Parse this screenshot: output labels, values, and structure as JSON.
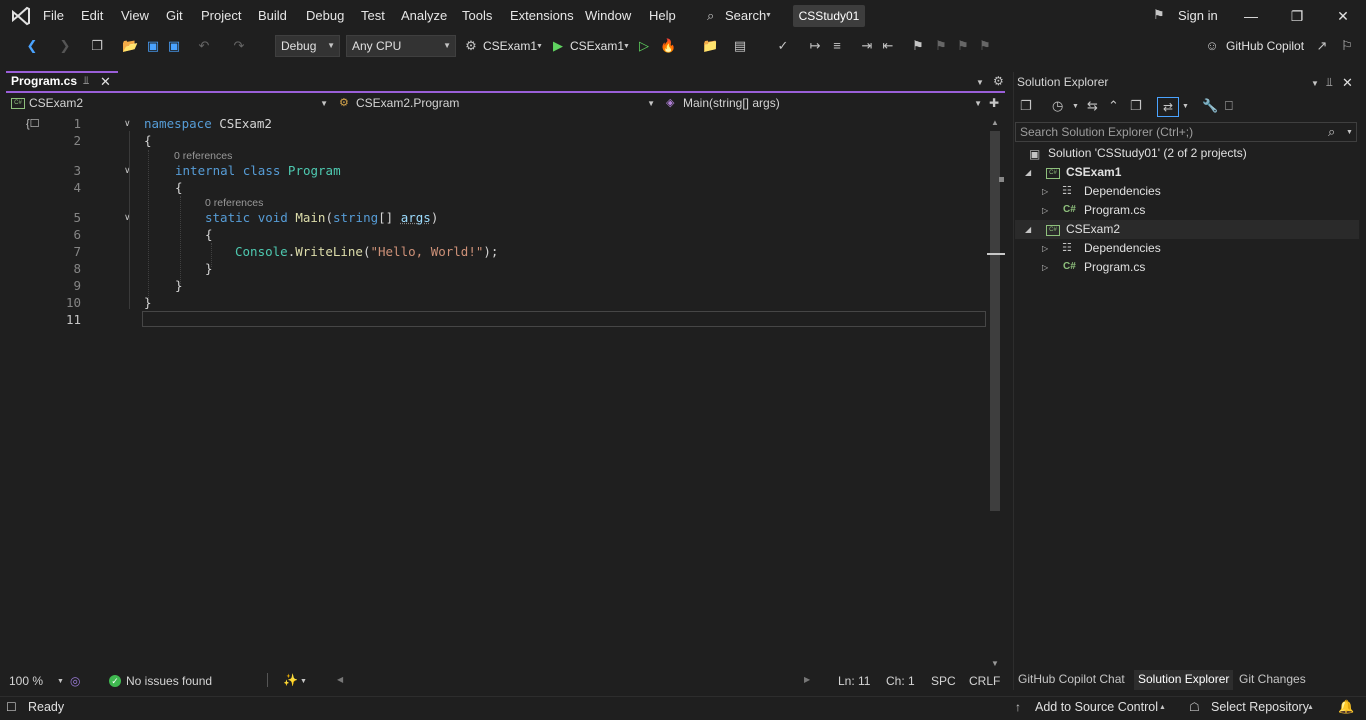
{
  "menu": {
    "items": [
      {
        "label": "File"
      },
      {
        "label": "Edit"
      },
      {
        "label": "View"
      },
      {
        "label": "Git"
      },
      {
        "label": "Project"
      },
      {
        "label": "Build"
      },
      {
        "label": "Debug"
      },
      {
        "label": "Test"
      },
      {
        "label": "Analyze"
      },
      {
        "label": "Tools"
      },
      {
        "label": "Extensions"
      },
      {
        "label": "Window"
      },
      {
        "label": "Help"
      }
    ],
    "search_label": "Search",
    "solution_name": "CSStudy01",
    "sign_in": "Sign in"
  },
  "toolbar": {
    "config": "Debug",
    "platform": "Any CPU",
    "startup_project": "CSExam1",
    "run_target": "CSExam1",
    "copilot": "GitHub Copilot"
  },
  "editor": {
    "tab_title": "Program.cs",
    "nav_project": "CSExam2",
    "nav_type": "CSExam2.Program",
    "nav_member": "Main(string[] args)",
    "line_numbers": [
      "1",
      "2",
      "3",
      "4",
      "5",
      "6",
      "7",
      "8",
      "9",
      "10",
      "11"
    ],
    "codelens": "0 references",
    "code": {
      "l1_kw": "namespace",
      "l1_name": "CSExam2",
      "open_brace": "{",
      "close_brace": "}",
      "l3_kw1": "internal",
      "l3_kw2": "class",
      "l3_name": "Program",
      "l5_kw1": "static",
      "l5_kw2": "void",
      "l5_meth": "Main",
      "l5_paren_open": "(",
      "l5_type": "string",
      "l5_arr": "[] ",
      "l5_param": "args",
      "l5_paren_close": ")",
      "l7_type": "Console",
      "l7_dot": ".",
      "l7_meth": "WriteLine",
      "l7_paren_open": "(",
      "l7_str": "\"Hello, World!\"",
      "l7_end": ");"
    },
    "zoom": "100 %",
    "issues": "No issues found",
    "ln": "Ln: 11",
    "ch": "Ch: 1",
    "spc": "SPC",
    "crlf": "CRLF"
  },
  "solution_explorer": {
    "title": "Solution Explorer",
    "search_placeholder": "Search Solution Explorer (Ctrl+;)",
    "solution_label": "Solution 'CSStudy01' (2 of 2 projects)",
    "projects": [
      {
        "name": "CSExam1",
        "dependencies": "Dependencies",
        "file": "Program.cs"
      },
      {
        "name": "CSExam2",
        "dependencies": "Dependencies",
        "file": "Program.cs"
      }
    ],
    "cs_badge": "C#",
    "tabs": [
      {
        "label": "GitHub Copilot Chat"
      },
      {
        "label": "Solution Explorer"
      },
      {
        "label": "Git Changes"
      }
    ]
  },
  "status": {
    "ready": "Ready",
    "source_control": "Add to Source Control",
    "repository": "Select Repository"
  },
  "colors": {
    "accent": "#9a5fd8",
    "keyword": "#569cd6",
    "type": "#4ec9b0",
    "method": "#dcdcaa",
    "string": "#ce9178"
  }
}
